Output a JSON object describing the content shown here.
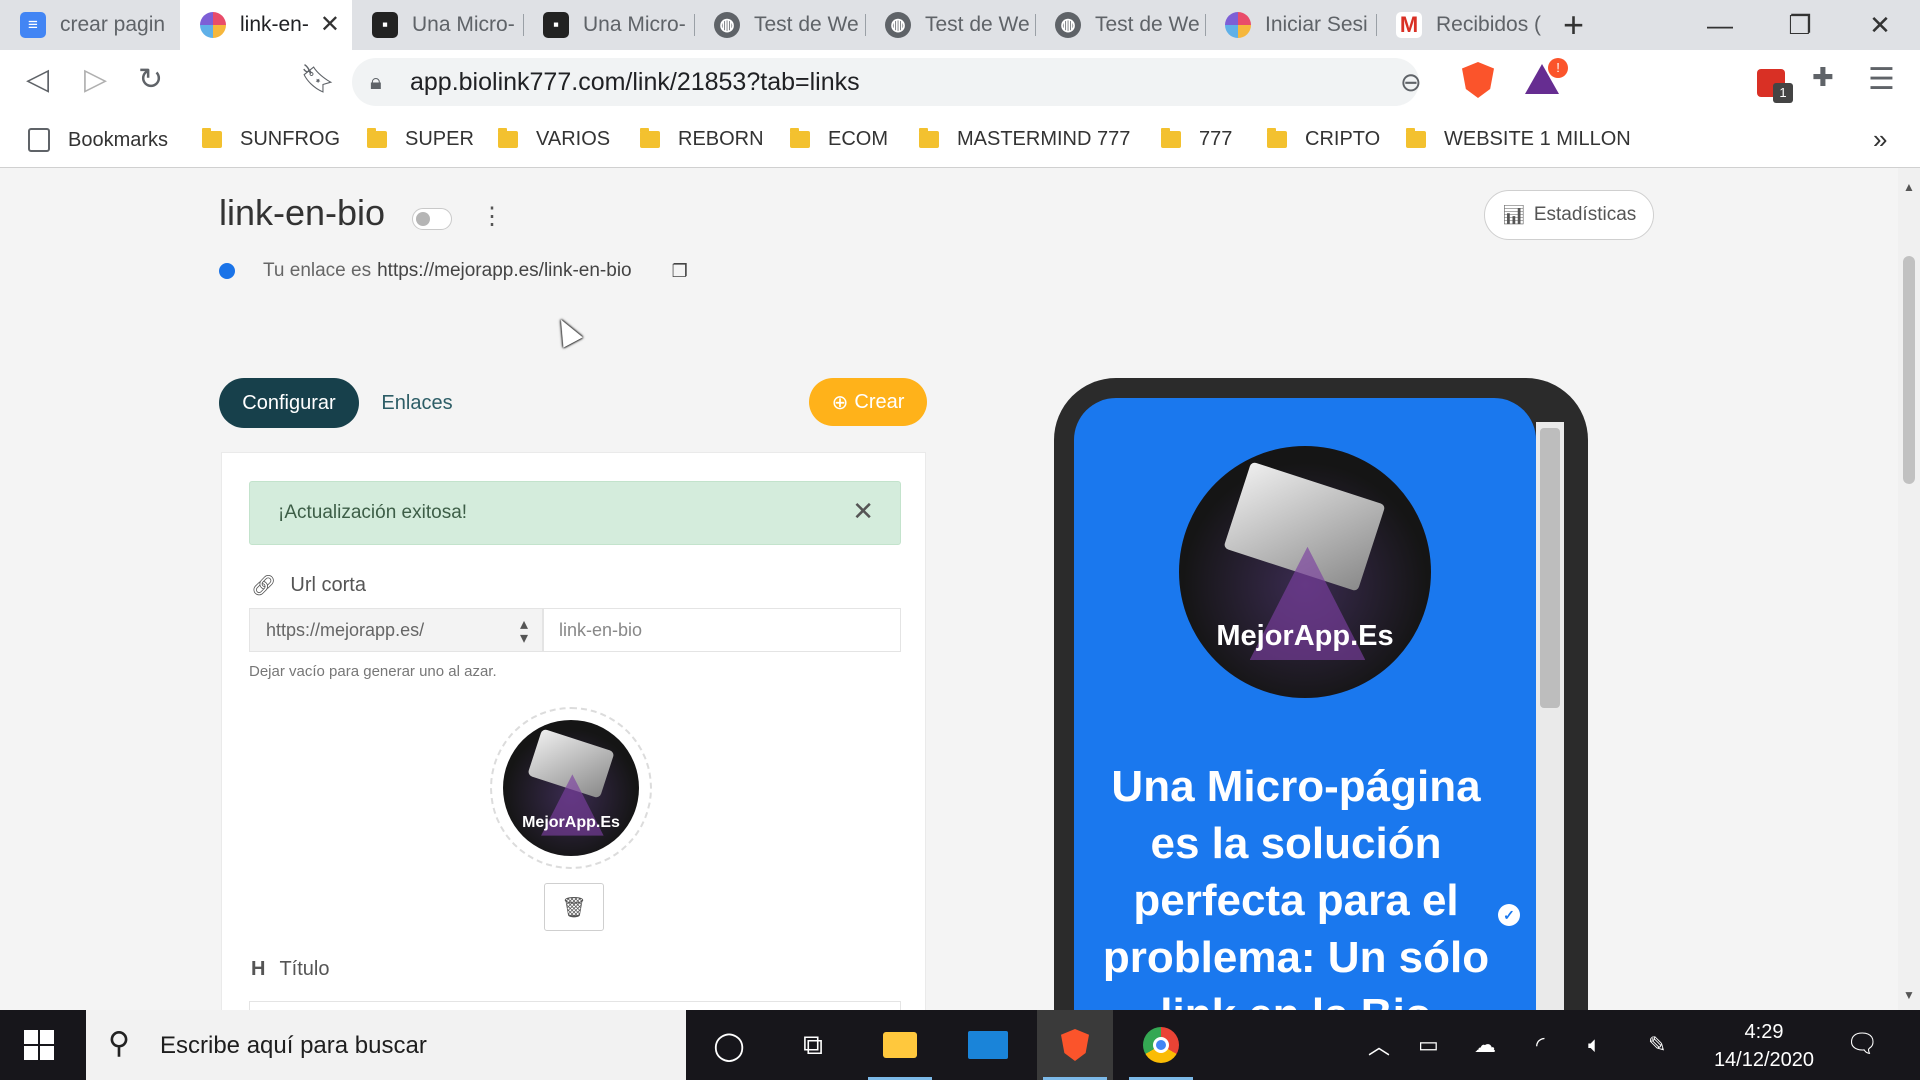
{
  "browser": {
    "tabs": [
      {
        "title": "crear pagin",
        "icon": "docs-icon",
        "active": false
      },
      {
        "title": "link-en-",
        "icon": "biolink-icon",
        "active": true
      },
      {
        "title": "Una Micro-",
        "icon": "page-icon",
        "active": false
      },
      {
        "title": "Una Micro-",
        "icon": "page-icon",
        "active": false
      },
      {
        "title": "Test de We",
        "icon": "globe-icon",
        "active": false
      },
      {
        "title": "Test de We",
        "icon": "globe-icon",
        "active": false
      },
      {
        "title": "Test de We",
        "icon": "globe-icon",
        "active": false
      },
      {
        "title": "Iniciar Sesi",
        "icon": "biolink-icon",
        "active": false
      },
      {
        "title": "Recibidos (",
        "icon": "gmail-icon",
        "active": false
      }
    ],
    "url": "app.biolink777.com/link/21853?tab=links",
    "bookmarks_label": "Bookmarks",
    "bookmark_folders": [
      "SUNFROG",
      "SUPER",
      "VARIOS",
      "REBORN",
      "ECOM",
      "MASTERMIND 777",
      "777",
      "CRIPTO",
      "WEBSITE 1 MILLON"
    ],
    "rewards_badge": "!",
    "extension_badge": "1",
    "more_bookmarks": "»"
  },
  "page": {
    "title": "link-en-bio",
    "stats_label": "Estadísticas",
    "link_prefix": "Tu enlace es",
    "link_url": "https://mejorapp.es/link-en-bio",
    "tab_config": "Configurar",
    "tab_links": "Enlaces",
    "create_label": "Crear",
    "alert": "¡Actualización exitosa!",
    "short_url_label": "Url corta",
    "domain_select": "https://mejorapp.es/",
    "slug_value": "link-en-bio",
    "help_text": "Dejar vacío para generar uno al azar.",
    "avatar_brand": "MejorApp.Es",
    "title_label": "Título"
  },
  "preview": {
    "brand": "MejorApp.Es",
    "headline": "Una Micro-página es la solución perfecta para el problema: Un sólo link en la Bio"
  },
  "taskbar": {
    "search_placeholder": "Escribe aquí para buscar",
    "time": "4:29",
    "date": "14/12/2020"
  },
  "colors": {
    "accent_dark": "#17404b",
    "create_orange": "#ffb21a",
    "preview_blue": "#1a78ee",
    "success_bg": "#d4ecdc"
  }
}
